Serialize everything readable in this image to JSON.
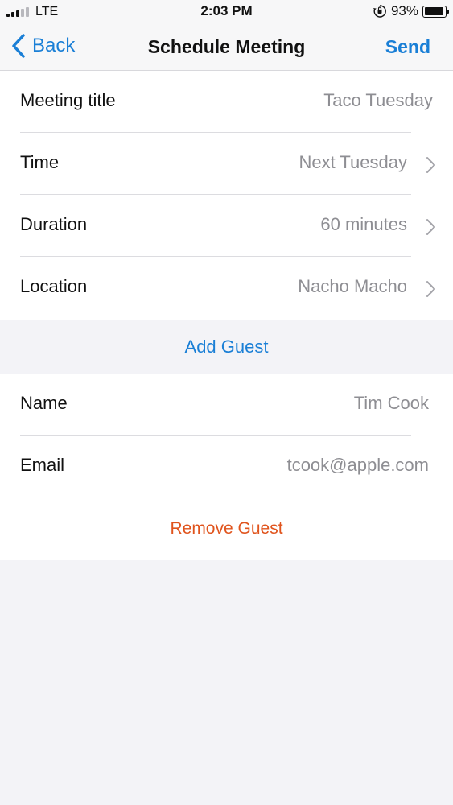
{
  "status_bar": {
    "carrier": "LTE",
    "time": "2:03 PM",
    "battery_percent": "93%",
    "battery_level": 0.93
  },
  "nav": {
    "back_label": "Back",
    "title": "Schedule Meeting",
    "send_label": "Send"
  },
  "meeting": {
    "title_label": "Meeting title",
    "title_value": "Taco Tuesday",
    "time_label": "Time",
    "time_value": "Next Tuesday",
    "duration_label": "Duration",
    "duration_value": "60 minutes",
    "location_label": "Location",
    "location_value": "Nacho Macho"
  },
  "add_guest_label": "Add Guest",
  "guest": {
    "name_label": "Name",
    "name_value": "Tim Cook",
    "email_label": "Email",
    "email_value": "tcook@apple.com",
    "remove_label": "Remove Guest"
  },
  "colors": {
    "accent": "#1a7fd6",
    "destructive": "#e0541d",
    "secondary_text": "#8e8e93",
    "background": "#f3f3f7"
  },
  "icons": [
    "signal-bars-icon",
    "orientation-lock-icon",
    "battery-icon",
    "chevron-left-icon",
    "chevron-right-icon"
  ]
}
